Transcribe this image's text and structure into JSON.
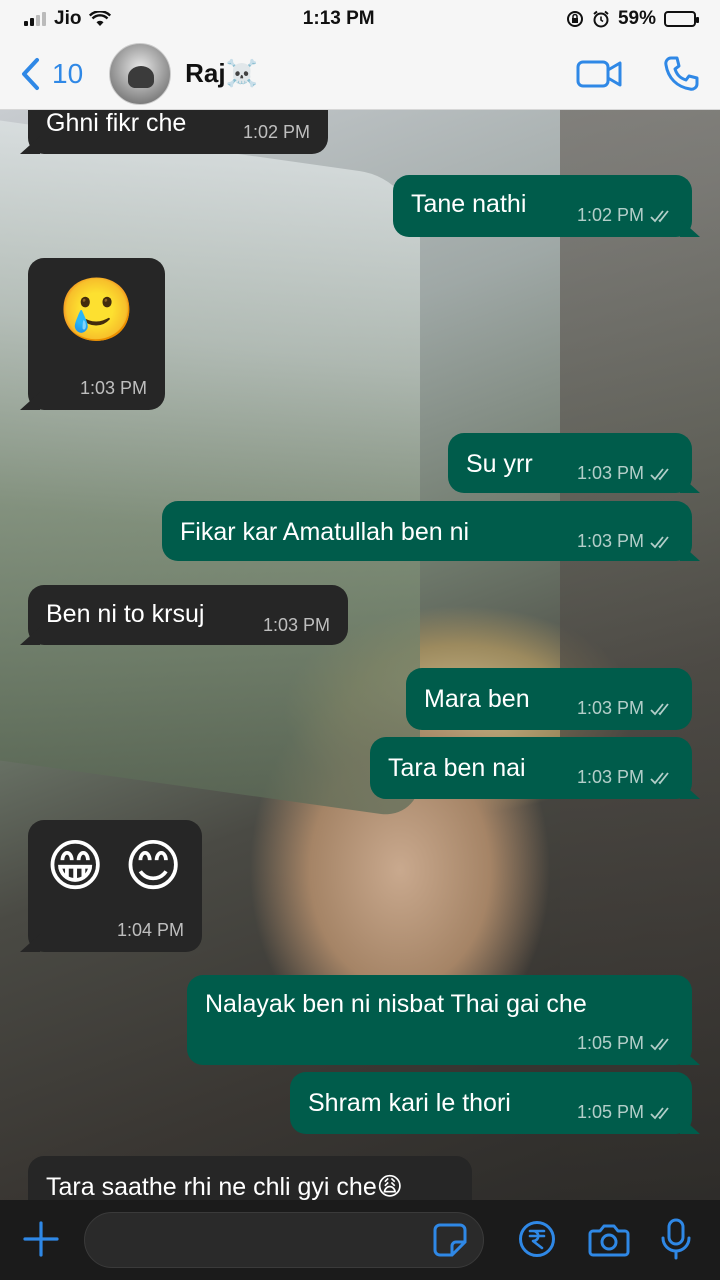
{
  "status_bar": {
    "carrier": "Jio",
    "time": "1:13 PM",
    "battery": "59%"
  },
  "header": {
    "back_count": "10",
    "contact_name": "Raj☠️"
  },
  "messages": [
    {
      "dir": "in",
      "text": "Ghni fikr che",
      "time": "1:02 PM"
    },
    {
      "dir": "out",
      "text": "Tane nathi",
      "time": "1:02 PM"
    },
    {
      "dir": "in",
      "text": "🥲",
      "time": "1:03 PM"
    },
    {
      "dir": "out",
      "text": "Su yrr",
      "time": "1:03 PM"
    },
    {
      "dir": "out",
      "text": "Fikar kar Amatullah ben ni",
      "time": "1:03 PM"
    },
    {
      "dir": "in",
      "text": "Ben ni to krsuj",
      "time": "1:03 PM"
    },
    {
      "dir": "out",
      "text": "Mara ben",
      "time": "1:03 PM"
    },
    {
      "dir": "out",
      "text": "Tara ben nai",
      "time": "1:03 PM"
    },
    {
      "dir": "in",
      "text": "😁 😊",
      "time": "1:04 PM"
    },
    {
      "dir": "out",
      "text": "Nalayak ben ni nisbat Thai gai che",
      "time": "1:05 PM"
    },
    {
      "dir": "out",
      "text": "Shram kari le thori",
      "time": "1:05 PM"
    },
    {
      "dir": "in",
      "text": "Tara saathe rhi ne chli gyi che😩",
      "time": ""
    }
  ],
  "colors": {
    "accent": "#2f88e6",
    "incoming_bubble": "#262626",
    "outgoing_bubble": "#005c4b"
  },
  "icons": [
    "back-chevron-icon",
    "video-call-icon",
    "voice-call-icon",
    "plus-icon",
    "sticker-icon",
    "rupee-payment-icon",
    "camera-icon",
    "microphone-icon"
  ]
}
